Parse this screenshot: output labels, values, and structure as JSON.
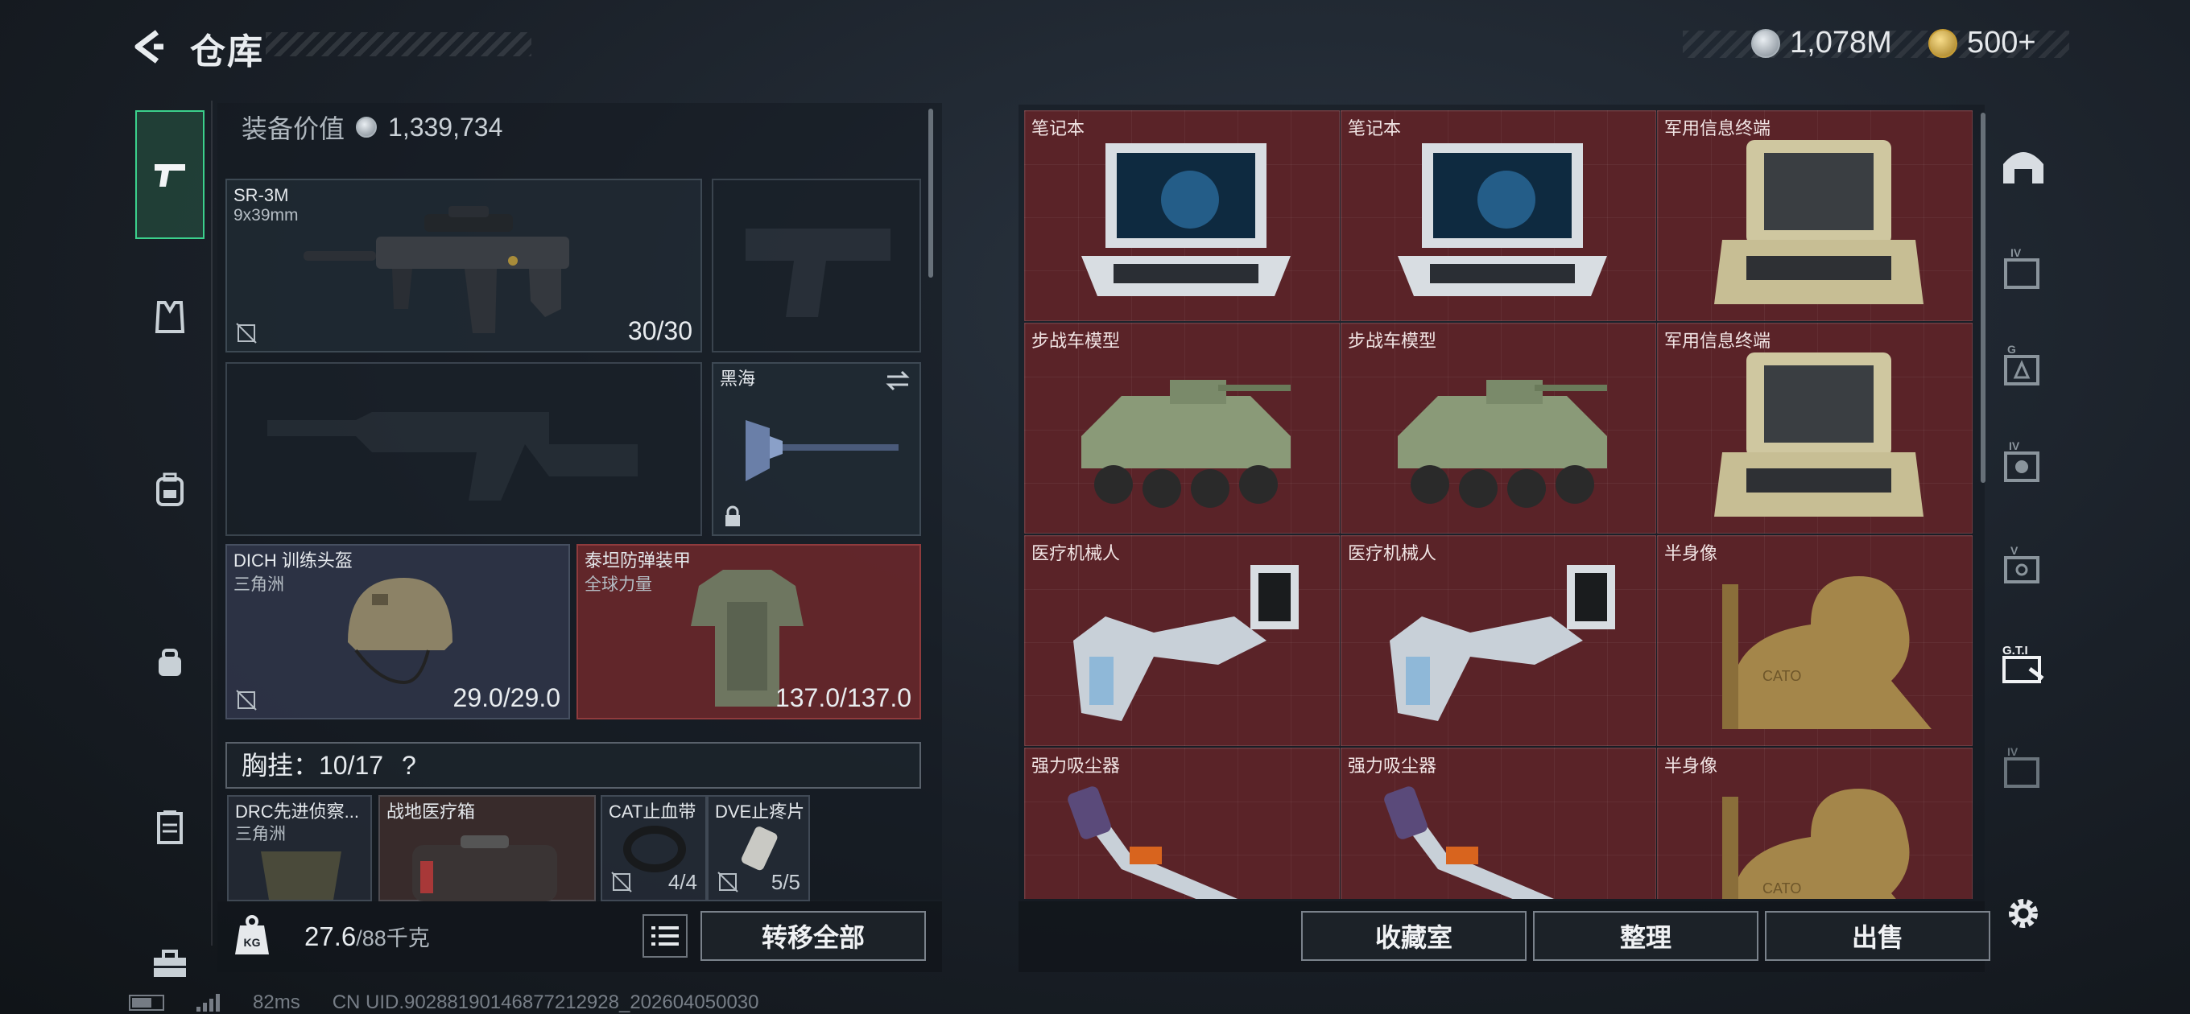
{
  "header": {
    "title": "仓库",
    "currency_silver": "1,078M",
    "currency_gold": "500+"
  },
  "left": {
    "equip_value_label": "装备价值",
    "equip_value": "1,339,734",
    "primary_weapon": {
      "name": "SR-3M",
      "caliber": "9x39mm",
      "ammo": "30/30"
    },
    "melee": {
      "name": "黑海"
    },
    "helmet": {
      "name": "DICH 训练头盔",
      "faction": "三角洲",
      "durability": "29.0/29.0"
    },
    "armor": {
      "name": "泰坦防弹装甲",
      "faction": "全球力量",
      "durability": "137.0/137.0"
    },
    "chest_rig": {
      "label": "胸挂：10/17",
      "help": "?"
    },
    "rig_items": [
      {
        "name": "DRC先进侦察...",
        "sub": "三角洲",
        "count": ""
      },
      {
        "name": "战地医疗箱",
        "sub": "",
        "count": ""
      },
      {
        "name": "CAT止血带",
        "sub": "",
        "count": "4/4"
      },
      {
        "name": "DVE止疼片",
        "sub": "",
        "count": "5/5"
      }
    ],
    "weight": {
      "value": "27.6",
      "max": "/88千克",
      "icon_label": "KG"
    },
    "transfer_all": "转移全部"
  },
  "grid": {
    "items": [
      {
        "name": "笔记本",
        "art": "laptop"
      },
      {
        "name": "笔记本",
        "art": "laptop"
      },
      {
        "name": "军用信息终端",
        "art": "terminal"
      },
      {
        "name": "步战车模型",
        "art": "ifv"
      },
      {
        "name": "步战车模型",
        "art": "ifv"
      },
      {
        "name": "军用信息终端",
        "art": "terminal"
      },
      {
        "name": "医疗机械人",
        "art": "robot"
      },
      {
        "name": "医疗机械人",
        "art": "robot"
      },
      {
        "name": "半身像",
        "art": "bust"
      },
      {
        "name": "强力吸尘器",
        "art": "vacuum"
      },
      {
        "name": "强力吸尘器",
        "art": "vacuum"
      },
      {
        "name": "半身像",
        "art": "bust"
      }
    ],
    "bust_engraving": "CATO"
  },
  "bottom_right": {
    "collection": "收藏室",
    "organize": "整理",
    "sell": "出售"
  },
  "right_nav": {
    "items": [
      "",
      "IV",
      "G",
      "IV",
      "V",
      "G.T.I",
      "IV"
    ]
  },
  "footer": {
    "ping": "82ms",
    "uid": "CN UID.90288190146877212928_202604050030"
  },
  "colors": {
    "accent_green": "#3bd08c",
    "cell_red": "#5a2328",
    "panel": "#141a20"
  }
}
